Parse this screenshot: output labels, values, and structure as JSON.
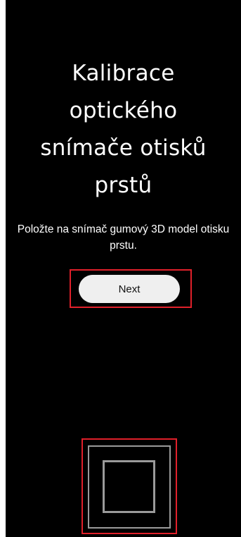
{
  "screen": {
    "title": "Kalibrace\noptického\nsnímače otisků\nprstů",
    "instruction": "Položte na snímač gumový 3D model otisku prstu.",
    "next_label": "Next"
  },
  "colors": {
    "background": "#000000",
    "text": "#ffffff",
    "button_background": "#efefef",
    "highlight": "#e0202a",
    "sensor_outline": "#9a9a9a"
  },
  "icons": {
    "sensor": "fingerprint-sensor-icon"
  }
}
